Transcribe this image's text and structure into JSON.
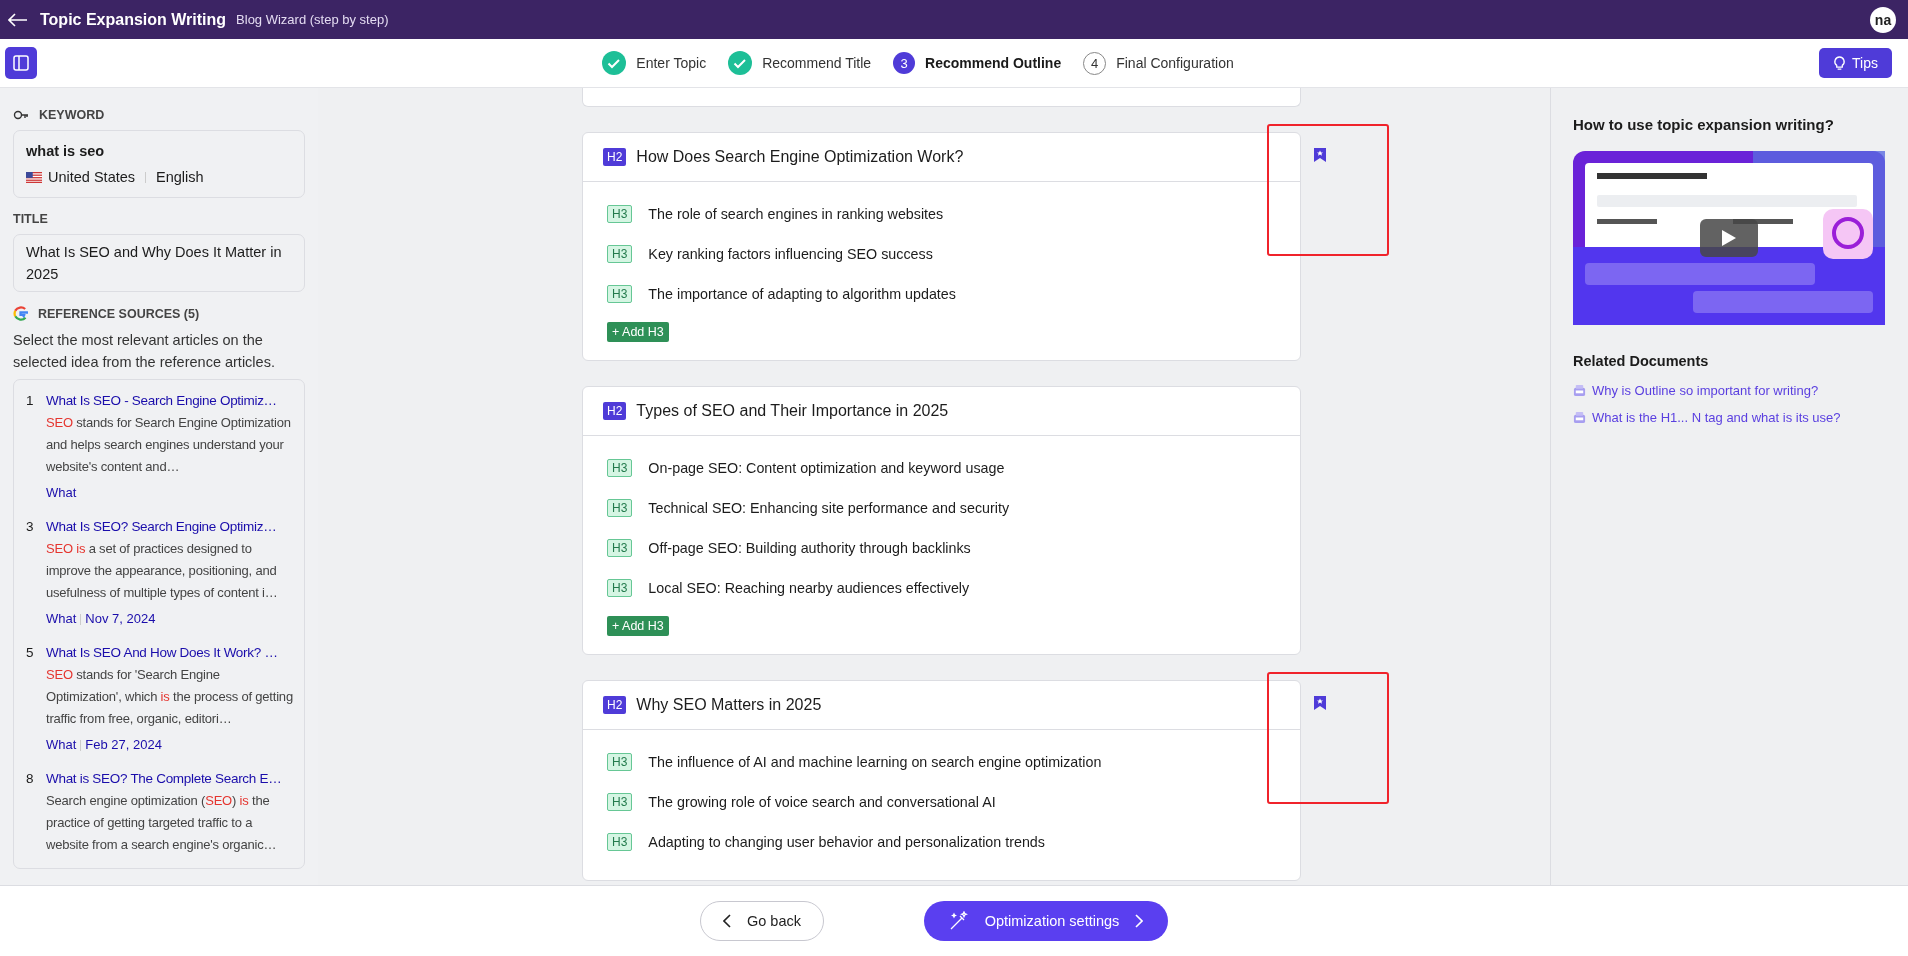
{
  "header": {
    "title": "Topic Expansion Writing",
    "subtitle": "Blog Wizard (step by step)",
    "avatar": "na"
  },
  "steps": [
    {
      "label": "Enter Topic",
      "done": true,
      "current": false
    },
    {
      "label": "Recommend Title",
      "done": true,
      "current": false
    },
    {
      "label": "Recommend Outline",
      "done": false,
      "current": true,
      "number": "3"
    },
    {
      "label": "Final Configuration",
      "done": false,
      "current": false,
      "number": "4"
    }
  ],
  "tips_button": "Tips",
  "sidebar": {
    "keyword_label": "KEYWORD",
    "keyword": "what is seo",
    "country": "United States",
    "language": "English",
    "title_label": "TITLE",
    "title": "What Is SEO and Why Does It Matter in 2025",
    "sources_label": "REFERENCE SOURCES (5)",
    "sources_hint": "Select the most relevant articles on the selected idea from the reference articles.",
    "sources": [
      {
        "rank": "1",
        "title": "What Is SEO - Search Engine Optimiz…",
        "snippet": [
          {
            "text": "SEO",
            "highlight": true
          },
          {
            "text": " stands for Search Engine Optimization and helps search engines understand your website's content and…",
            "highlight": false
          }
        ],
        "tag": "What"
      },
      {
        "rank": "3",
        "title": "What Is SEO? Search Engine Optimiz…",
        "snippet": [
          {
            "text": "SEO is",
            "highlight": true
          },
          {
            "text": " a set of practices designed to improve the appearance, positioning, and usefulness of multiple types of content i…",
            "highlight": false
          }
        ],
        "tag": "What",
        "date": "Nov 7, 2024"
      },
      {
        "rank": "5",
        "title": "What Is SEO And How Does It Work? …",
        "snippet": [
          {
            "text": "SEO",
            "highlight": true
          },
          {
            "text": " stands for 'Search Engine Optimization', which ",
            "highlight": false
          },
          {
            "text": "is",
            "highlight": true
          },
          {
            "text": " the process of getting traffic from free, organic, editori…",
            "highlight": false
          }
        ],
        "tag": "What",
        "date": "Feb 27, 2024"
      },
      {
        "rank": "8",
        "title": "What is SEO? The Complete Search E…",
        "snippet": [
          {
            "text": "Search engine optimization (",
            "highlight": false
          },
          {
            "text": "SEO",
            "highlight": true
          },
          {
            "text": ") ",
            "highlight": false
          },
          {
            "text": "is",
            "highlight": true
          },
          {
            "text": " the practice of getting targeted traffic to a website from a search engine's organic…",
            "highlight": false
          }
        ]
      }
    ]
  },
  "outline": [
    {
      "tag": "H2",
      "heading": "How Does Search Engine Optimization Work?",
      "bookmarked": true,
      "annotated": true,
      "add_label": "+ Add H3",
      "subheadings": [
        {
          "tag": "H3",
          "text": "The role of search engines in ranking websites"
        },
        {
          "tag": "H3",
          "text": "Key ranking factors influencing SEO success"
        },
        {
          "tag": "H3",
          "text": "The importance of adapting to algorithm updates"
        }
      ]
    },
    {
      "tag": "H2",
      "heading": "Types of SEO and Their Importance in 2025",
      "bookmarked": false,
      "annotated": false,
      "add_label": "+ Add H3",
      "subheadings": [
        {
          "tag": "H3",
          "text": "On-page SEO: Content optimization and keyword usage"
        },
        {
          "tag": "H3",
          "text": "Technical SEO: Enhancing site performance and security"
        },
        {
          "tag": "H3",
          "text": "Off-page SEO: Building authority through backlinks"
        },
        {
          "tag": "H3",
          "text": "Local SEO: Reaching nearby audiences effectively"
        }
      ]
    },
    {
      "tag": "H2",
      "heading": "Why SEO Matters in 2025",
      "bookmarked": true,
      "annotated": true,
      "subheadings": [
        {
          "tag": "H3",
          "text": "The influence of AI and machine learning on search engine optimization"
        },
        {
          "tag": "H3",
          "text": "The growing role of voice search and conversational AI"
        },
        {
          "tag": "H3",
          "text": "Adapting to changing user behavior and personalization trends"
        }
      ]
    }
  ],
  "help": {
    "title": "How to use topic expansion writing?",
    "video": {
      "kind": "picture"
    },
    "related_title": "Related Documents",
    "related": [
      "Why is Outline so important for writing?",
      "What is the H1... N tag and what is its use?"
    ]
  },
  "footer": {
    "back": "Go back",
    "next": "Optimization settings"
  }
}
